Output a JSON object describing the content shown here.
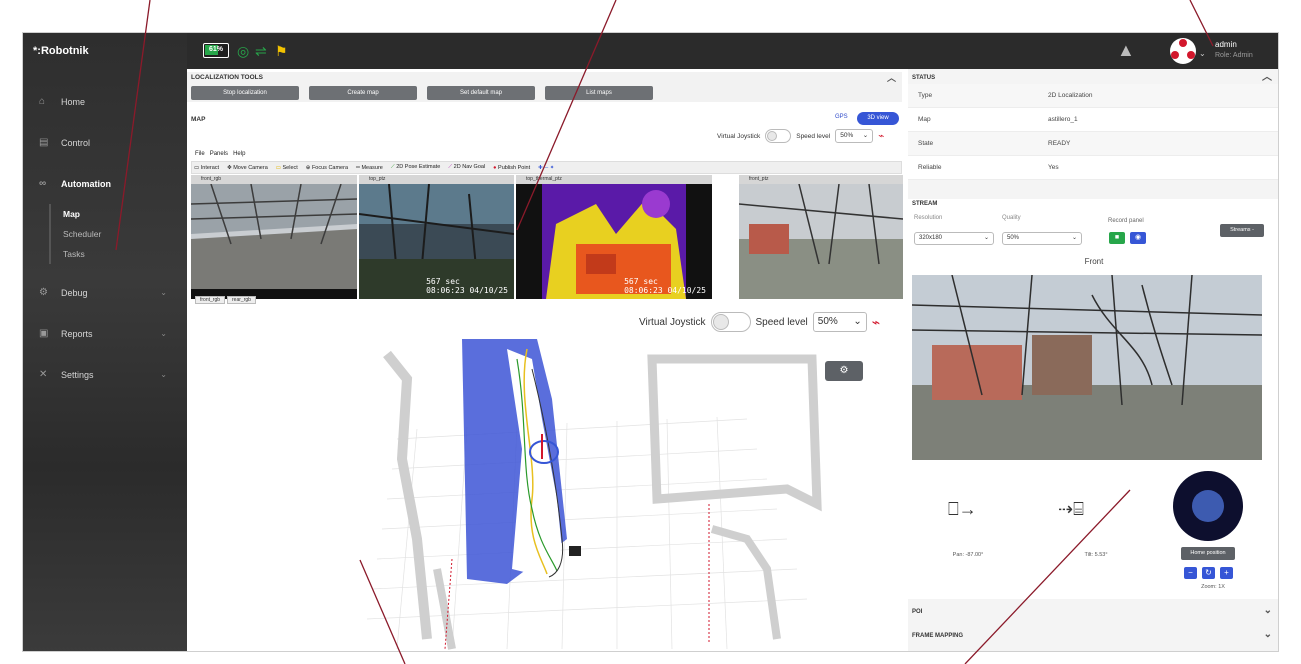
{
  "app": {
    "brand": "*:Robotnik",
    "battery_pct": "61%",
    "battery_level": 0.61,
    "user": {
      "name": "admin",
      "role": "Role: Admin"
    },
    "colors": {
      "accent": "#3656d6",
      "ok": "#27a64a",
      "brand_red": "#d2172c",
      "sidebar": "#2e2e2e"
    }
  },
  "sidebar": {
    "items": [
      {
        "label": "Home",
        "icon": "home-icon"
      },
      {
        "label": "Control",
        "icon": "gamepad-icon"
      },
      {
        "label": "Automation",
        "icon": "automation-icon"
      },
      {
        "label": "Debug",
        "icon": "bug-icon"
      },
      {
        "label": "Reports",
        "icon": "report-icon"
      },
      {
        "label": "Settings",
        "icon": "settings-icon"
      }
    ],
    "automation_sub": [
      "Map",
      "Scheduler",
      "Tasks"
    ]
  },
  "localization": {
    "title": "LOCALIZATION TOOLS",
    "buttons": [
      "Stop localization",
      "Create map",
      "Set default map",
      "List maps"
    ]
  },
  "map": {
    "title": "MAP",
    "gps": "GPS",
    "view3d": "3D view",
    "virtual_joystick": "Virtual Joystick",
    "speed_level_label": "Speed level",
    "speed_level": "50%",
    "menu": [
      "File",
      "Panels",
      "Help"
    ],
    "tools": [
      "Interact",
      "Move Camera",
      "Select",
      "Focus Camera",
      "Measure",
      "2D Pose Estimate",
      "2D Nav Goal",
      "Publish Point"
    ],
    "cameras": [
      {
        "title": "front_rgb",
        "ts": ""
      },
      {
        "title": "top_ptz",
        "ts1": "567 sec",
        "ts2": "08:06:23 04/10/25"
      },
      {
        "title": "top_thermal_ptz",
        "ts1": "567 sec",
        "ts2": "08:06:23 04/10/25"
      },
      {
        "title": "front_ptz",
        "ts": ""
      }
    ],
    "cam_tabs": [
      "front_rgb",
      "rear_rgb"
    ]
  },
  "status": {
    "title": "STATUS",
    "rows": [
      {
        "k": "Type",
        "v": "2D Localization"
      },
      {
        "k": "Map",
        "v": "astillero_1"
      },
      {
        "k": "State",
        "v": "READY"
      },
      {
        "k": "Reliable",
        "v": "Yes"
      }
    ]
  },
  "stream": {
    "title": "STREAM",
    "resolution_label": "Resolution",
    "resolution": "320x180",
    "quality_label": "Quality",
    "quality": "50%",
    "record_label": "Record panel",
    "streams_btn": "Streams -",
    "camera_name": "Front",
    "pan": "Pan: -87.00°",
    "tilt": "Tilt: 5.53°",
    "home_position": "Home position",
    "zoom": "Zoom: 1X"
  },
  "poi": {
    "title": "POI"
  },
  "frame_mapping": {
    "title": "FRAME MAPPING"
  }
}
